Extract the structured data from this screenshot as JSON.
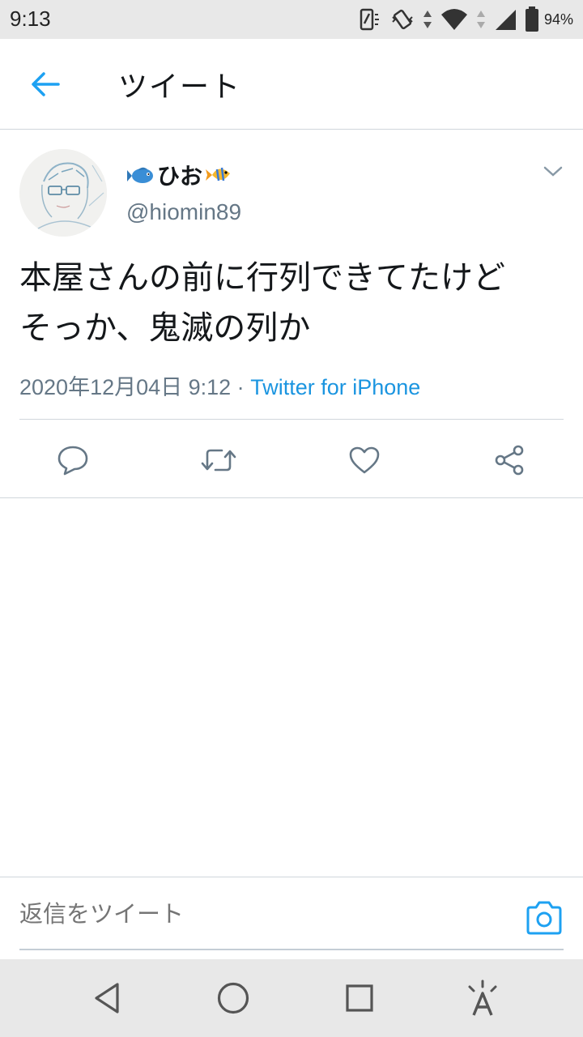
{
  "status_bar": {
    "time": "9:13",
    "battery_percent": "94%",
    "icons": [
      "nfc-icon",
      "vibrate-icon",
      "wifi-icon",
      "signal-icon",
      "battery-icon"
    ]
  },
  "header": {
    "title": "ツイート",
    "back_icon": "arrow-left-icon"
  },
  "tweet": {
    "display_name": "ひお",
    "handle": "@hiomin89",
    "text_line1": "本屋さんの前に行列できてたけど",
    "text_line2": "そっか、鬼滅の列か",
    "timestamp": "2020年12月04日 9:12 · ",
    "source": "Twitter for iPhone",
    "actions": [
      "reply-icon",
      "retweet-icon",
      "like-icon",
      "share-icon"
    ]
  },
  "reply": {
    "placeholder": "返信をツイート"
  },
  "colors": {
    "accent": "#1da1f2",
    "source_link": "#1b95e0",
    "secondary_text": "#657786",
    "divider": "#d0d6dc"
  }
}
